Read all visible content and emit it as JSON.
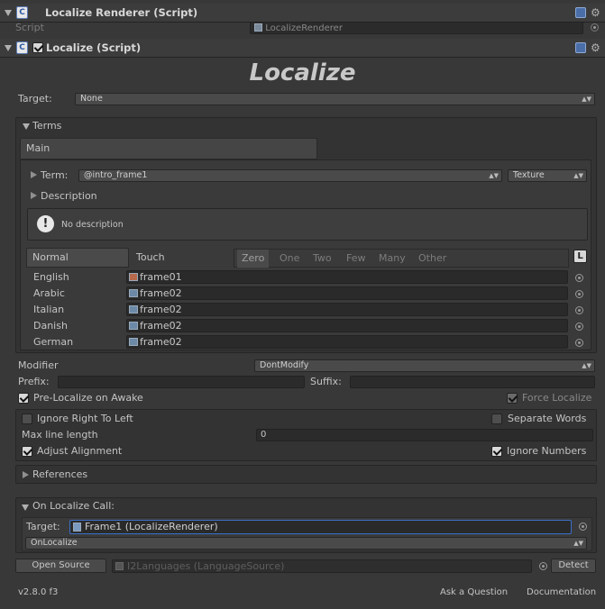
{
  "renderer": {
    "title": "Localize Renderer (Script)",
    "script_label": "Script",
    "script_value": "LocalizeRenderer"
  },
  "localize": {
    "title": "Localize (Script)",
    "heading": "Localize",
    "target_label": "Target:",
    "target_value": "None"
  },
  "terms": {
    "section_label": "Terms",
    "category_tab": "Main",
    "term_label": "Term:",
    "term_value": "@intro_frame1",
    "term_type": "Texture",
    "description_label": "Description",
    "description_text": "No description",
    "tabs": [
      "Normal",
      "Touch"
    ],
    "plurals": [
      "Zero",
      "One",
      "Two",
      "Few",
      "Many",
      "Other"
    ],
    "l_button": "L",
    "languages": [
      {
        "name": "English",
        "value": "frame01"
      },
      {
        "name": "Arabic",
        "value": "frame02"
      },
      {
        "name": "Italian",
        "value": "frame02"
      },
      {
        "name": "Danish",
        "value": "frame02"
      },
      {
        "name": "German",
        "value": "frame02"
      }
    ]
  },
  "modifier": {
    "label": "Modifier",
    "value": "DontModify",
    "prefix_label": "Prefix:",
    "suffix_label": "Suffix:",
    "prelocalize_label": "Pre-Localize on Awake",
    "prelocalize_checked": true,
    "force_localize_label": "Force Localize",
    "force_localize_checked": true
  },
  "rtl": {
    "ignore_rtl_label": "Ignore Right To Left",
    "separate_words_label": "Separate Words",
    "max_line_label": "Max line length",
    "max_line_value": "0",
    "adjust_alignment_label": "Adjust Alignment",
    "ignore_numbers_label": "Ignore Numbers"
  },
  "references_label": "References",
  "on_localize": {
    "section_label": "On Localize Call:",
    "target_label": "Target:",
    "target_value": "Frame1 (LocalizeRenderer)",
    "method_value": "OnLocalize"
  },
  "source": {
    "open_source_label": "Open Source",
    "source_value": "I2Languages (LanguageSource)",
    "detect_label": "Detect"
  },
  "footer": {
    "version": "v2.8.0 f3",
    "ask_question": "Ask a Question",
    "documentation": "Documentation"
  }
}
